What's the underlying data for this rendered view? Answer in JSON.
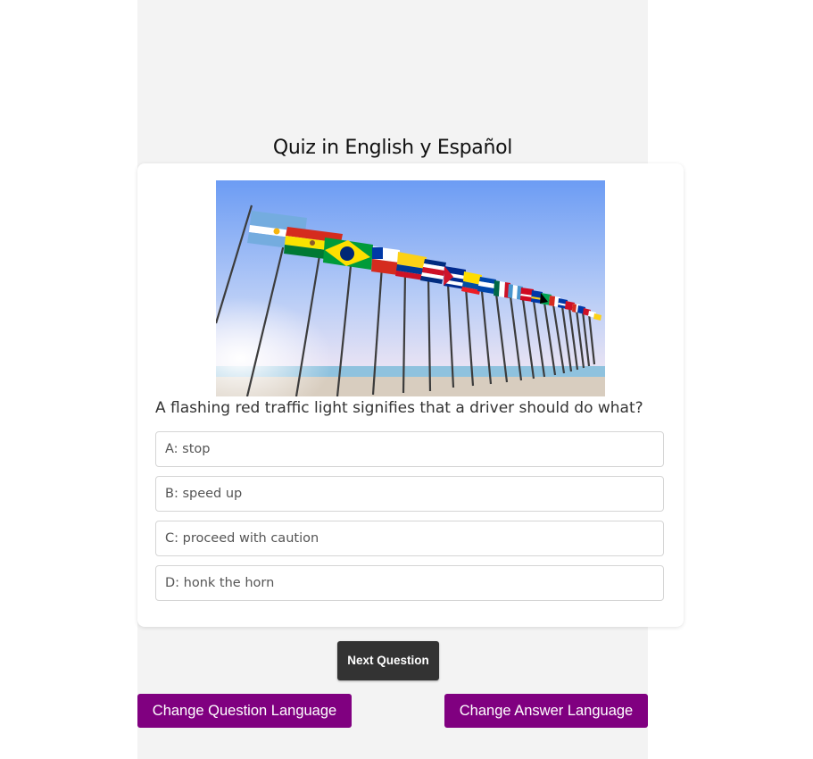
{
  "page": {
    "title": "Quiz in English y Español"
  },
  "quiz": {
    "image_alt": "Row of flags of Spanish-speaking countries",
    "question": "A flashing red traffic light signifies that a driver should do what?",
    "answers": [
      {
        "letter": "A",
        "text": "A: stop"
      },
      {
        "letter": "B",
        "text": "B: speed up"
      },
      {
        "letter": "C",
        "text": "C: proceed with caution"
      },
      {
        "letter": "D",
        "text": "D: honk the horn"
      }
    ]
  },
  "controls": {
    "next_label": "Next Question",
    "change_question_language_label": "Change Question Language",
    "change_answer_language_label": "Change Answer Language"
  },
  "colors": {
    "accent": "#800080",
    "dark_button": "#333333",
    "page_column": "#f3f3f3"
  }
}
